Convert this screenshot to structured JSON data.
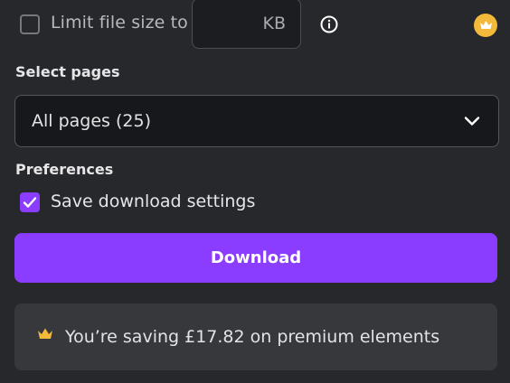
{
  "limit": {
    "label": "Limit file size to",
    "value": "",
    "unit": "KB",
    "checked": false
  },
  "select_pages": {
    "label": "Select pages",
    "value": "All pages (25)"
  },
  "preferences": {
    "label": "Preferences",
    "save_settings_label": "Save download settings",
    "save_settings_checked": true
  },
  "download": {
    "label": "Download"
  },
  "savings": {
    "text": "You’re saving £17.82 on premium elements"
  },
  "colors": {
    "background": "#27282b",
    "accent": "#8b3dff",
    "premium": "#f2b93b"
  },
  "icons": [
    "info-icon",
    "crown-icon",
    "chevron-down-icon",
    "checkmark-icon"
  ]
}
